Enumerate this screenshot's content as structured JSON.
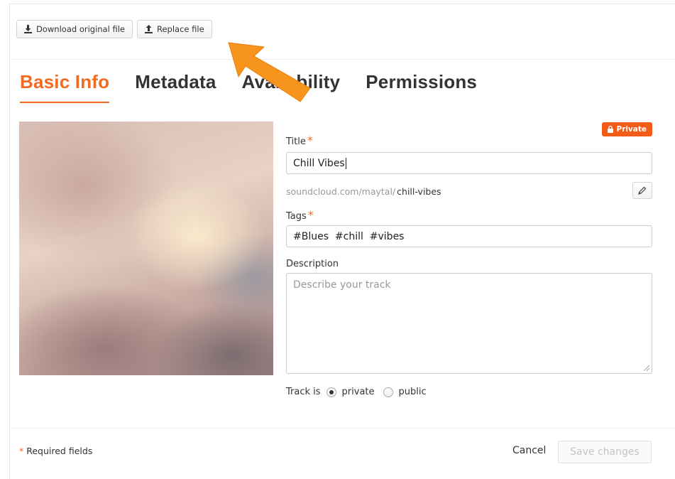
{
  "toolbar": {
    "download_label": "Download original file",
    "replace_label": "Replace file"
  },
  "tabs": [
    {
      "label": "Basic Info",
      "active": true
    },
    {
      "label": "Metadata",
      "active": false
    },
    {
      "label": "Availability",
      "active": false
    },
    {
      "label": "Permissions",
      "active": false
    }
  ],
  "form": {
    "privacy_badge": "Private",
    "title_label": "Title",
    "title_value": "Chill Vibes",
    "required_mark": "*",
    "url_base": "soundcloud.com/maytal/",
    "url_slug": "chill-vibes",
    "tags_label": "Tags",
    "tags_value": "#Blues  #chill  #vibes",
    "description_label": "Description",
    "description_placeholder": "Describe your track",
    "track_is_label": "Track is",
    "option_private": "private",
    "option_public": "public",
    "selected_visibility": "private"
  },
  "footer": {
    "required_mark": "*",
    "required_text": "Required fields",
    "cancel_label": "Cancel",
    "save_label": "Save changes"
  },
  "colors": {
    "accent": "#f26a22",
    "annotation_arrow": "#f7941d"
  },
  "icons": {
    "download": "download-icon",
    "upload": "upload-icon",
    "lock": "lock-icon",
    "pencil": "pencil-icon"
  }
}
